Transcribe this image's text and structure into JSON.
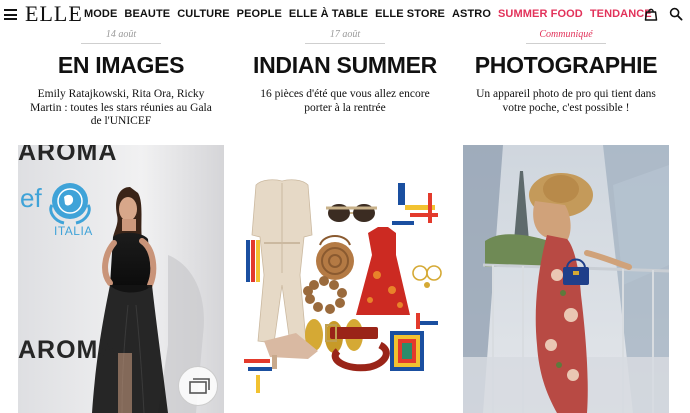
{
  "brand": {
    "logo": "ELLE"
  },
  "nav": {
    "items": [
      {
        "label": "MODE",
        "accent": false
      },
      {
        "label": "BEAUTE",
        "accent": false
      },
      {
        "label": "CULTURE",
        "accent": false
      },
      {
        "label": "PEOPLE",
        "accent": false
      },
      {
        "label": "ELLE À TABLE",
        "accent": false
      },
      {
        "label": "ELLE STORE",
        "accent": false
      },
      {
        "label": "ASTRO",
        "accent": false
      },
      {
        "label": "SUMMER FOOD",
        "accent": true
      },
      {
        "label": "TENDANCE",
        "accent": true
      }
    ],
    "icons": {
      "menu": "hamburger-menu-icon",
      "bag": "shopping-bag-icon",
      "search": "search-icon"
    }
  },
  "colors": {
    "accent": "#e2325a",
    "text": "#111111",
    "meta": "#9a9a9a"
  },
  "articles": [
    {
      "date": "14 août",
      "title": "EN IMAGES",
      "description": "Emily Ratajkowski, Rita Ora, Ricky Martin : toutes les stars réunies au Gala de l'UNICEF",
      "image_text": {
        "brand_top": "AROMA",
        "side": "ef",
        "unicef_label": "ITALIA",
        "brand_bottom": "AROMA"
      },
      "gallery_icon": "gallery-icon"
    },
    {
      "date": "17 août",
      "title": "INDIAN SUMMER",
      "description": "16 pièces d'été que vous allez encore porter à la rentrée"
    },
    {
      "date": "Communiqué",
      "title": "PHOTOGRAPHIE",
      "description": "Un appareil photo de pro qui tient dans votre poche, c'est possible !"
    }
  ]
}
